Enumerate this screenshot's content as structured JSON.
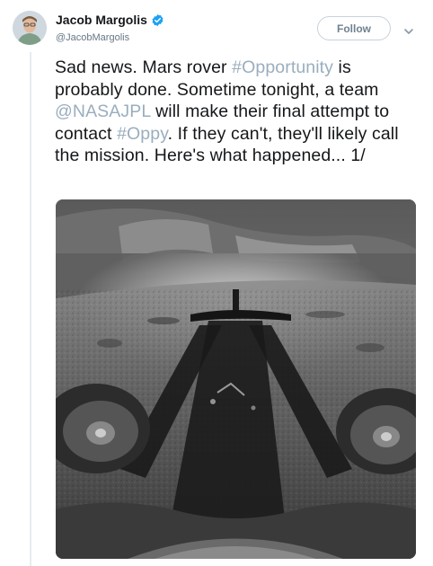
{
  "author": {
    "display_name": "Jacob Margolis",
    "handle": "@JacobMargolis",
    "verified": true
  },
  "follow_button": {
    "label": "Follow"
  },
  "menu": {
    "icon": "chevron-down-icon"
  },
  "tweet": {
    "segments": [
      {
        "text": "Sad news. Mars rover ",
        "link": false
      },
      {
        "text": "#Opportunity",
        "link": true
      },
      {
        "text": " is probably done. Sometime tonight, a team ",
        "link": false
      },
      {
        "text": "@NASAJPL",
        "link": true
      },
      {
        "text": " will make their final attempt to contact ",
        "link": false
      },
      {
        "text": "#Oppy",
        "link": true
      },
      {
        "text": ". If they can't, they'll likely call the mission. Here's what happened... 1/",
        "link": false
      }
    ]
  },
  "media": {
    "type": "photo"
  },
  "colors": {
    "link": "#9aaebe",
    "verified": "#1da1f2",
    "text": "#14171a",
    "muted": "#657786"
  }
}
